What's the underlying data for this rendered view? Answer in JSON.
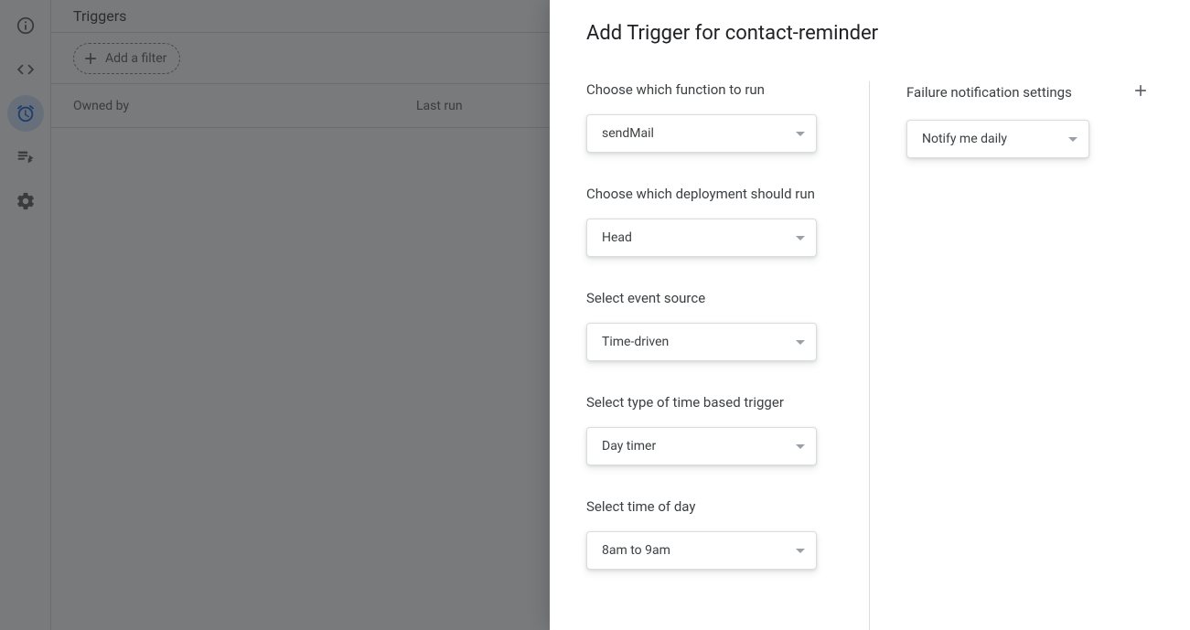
{
  "page": {
    "title": "Triggers",
    "filter_chip": "Add a filter",
    "columns": {
      "owned_by": "Owned by",
      "last_run": "Last run"
    }
  },
  "modal": {
    "title": "Add Trigger for contact-reminder",
    "left": {
      "function_label": "Choose which function to run",
      "function_value": "sendMail",
      "deployment_label": "Choose which deployment should run",
      "deployment_value": "Head",
      "event_source_label": "Select event source",
      "event_source_value": "Time-driven",
      "time_type_label": "Select type of time based trigger",
      "time_type_value": "Day timer",
      "time_of_day_label": "Select time of day",
      "time_of_day_value": "8am to 9am"
    },
    "right": {
      "failure_label": "Failure notification settings",
      "failure_value": "Notify me daily"
    }
  }
}
